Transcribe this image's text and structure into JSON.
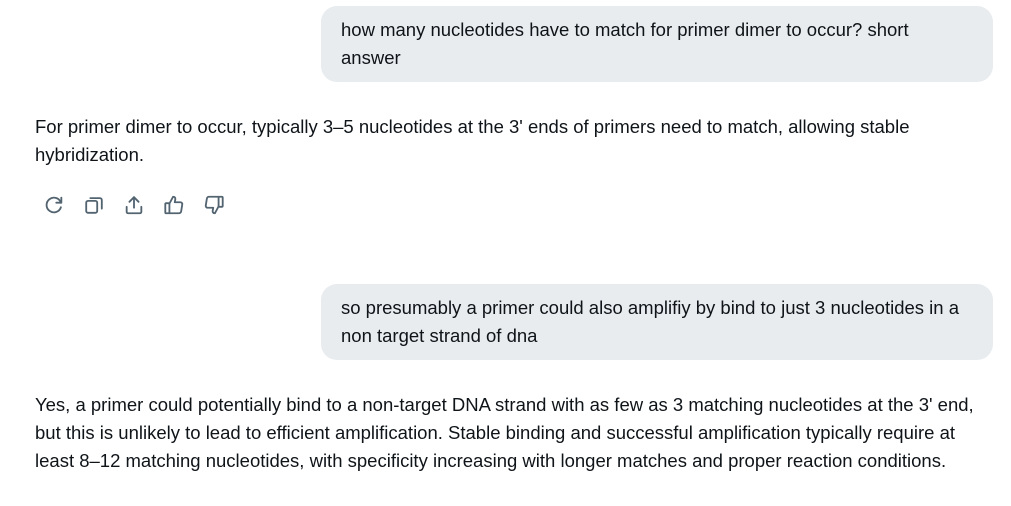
{
  "conversation": [
    {
      "role": "user",
      "text": "how many nucleotides have to match for primer dimer to occur? short answer"
    },
    {
      "role": "assistant",
      "text": "For primer dimer to occur, typically 3–5 nucleotides at the 3' ends of primers need to match, allowing stable hybridization."
    },
    {
      "role": "user",
      "text": "so presumably a primer could also amplifiy by bind to just 3 nucleotides in a non target strand of dna"
    },
    {
      "role": "assistant",
      "text": "Yes, a primer could potentially bind to a non-target DNA strand with as few as 3 matching nucleotides at the 3' end, but this is unlikely to lead to efficient amplification. Stable binding and successful amplification typically require at least 8–12 matching nucleotides, with specificity increasing with longer matches and proper reaction conditions."
    }
  ],
  "message_actions": {
    "icons": [
      "regenerate-icon",
      "copy-icon",
      "share-icon",
      "thumbs-up-icon",
      "thumbs-down-icon"
    ]
  },
  "colors": {
    "user_bubble_bg": "#e8ecef",
    "text": "#0f1419",
    "icon": "#536471",
    "background": "#ffffff"
  }
}
